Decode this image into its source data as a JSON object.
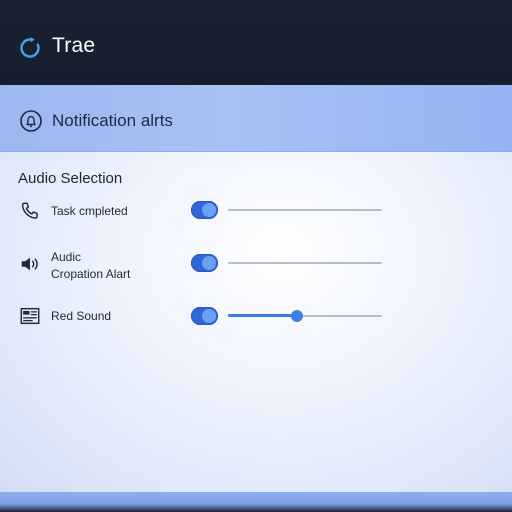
{
  "app": {
    "title": "Trae"
  },
  "header": {
    "title": "Notification alrts"
  },
  "section": {
    "title": "Audio Selection"
  },
  "rows": [
    {
      "label_line1": "Task cmpleted",
      "label_line2": "",
      "icon": "phone-icon",
      "enabled": true,
      "level": 0
    },
    {
      "label_line1": "Audic",
      "label_line2": "Cropation Alart",
      "icon": "speaker-icon",
      "enabled": true,
      "level": 0
    },
    {
      "label_line1": "Red Sound",
      "label_line2": "",
      "icon": "media-player-icon",
      "enabled": true,
      "level": 0.45
    }
  ],
  "colors": {
    "titlebar": "#1a2233",
    "header_band": "#a8c1f4",
    "accent": "#3166d8",
    "toggle_knob": "#6aa0f5",
    "track": "#b6bcc8"
  }
}
